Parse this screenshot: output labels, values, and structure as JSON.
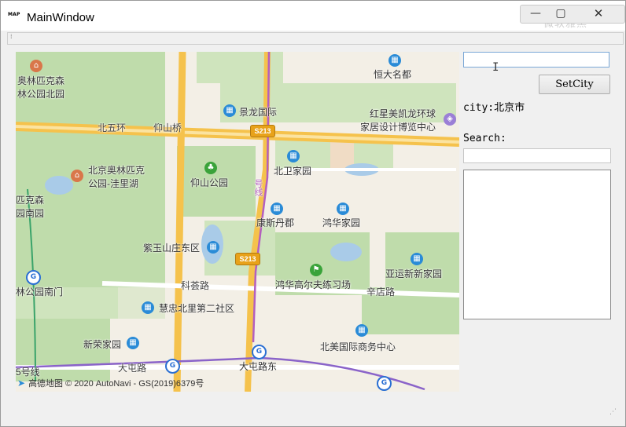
{
  "window": {
    "title": "MainWindow",
    "app_icon_text": "MAP",
    "controls": {
      "minimize": "—",
      "maximize": "▢",
      "close": "✕"
    },
    "watermark": "微软雅黑"
  },
  "map": {
    "labels": {
      "olympic_north_park": "奥林匹克森\n林公园北园",
      "hengda_mingdu": "恒大名都",
      "jinglong": "景龙国际",
      "redstar": "红星美凯龙环球\n家居设计博览中心",
      "beiwuhuan": "北五环",
      "yangshanqiao": "仰山桥",
      "olympic_wali": "北京奥林匹克\n公园-洼里湖",
      "yangshan_park": "仰山公园",
      "beiwei": "北卫家园",
      "olympic_south": "匹克森\n园南园",
      "kangsi": "康斯丹郡",
      "honghua": "鸿华家园",
      "ziyu": "紫玉山庄东区",
      "yayun": "亚运新新家园",
      "kehui": "科荟路",
      "honghua_golf": "鸿华高尔夫练习场",
      "xindian": "辛店路",
      "park_south_gate": "林公园南门",
      "huizhong": "慧忠北里第二社区",
      "beimei": "北美国际商务中心",
      "xinrong": "新荣家园",
      "datun_road": "大屯路",
      "datun_east": "大屯路东",
      "line5": "5号线",
      "line_number": "号线"
    },
    "shield": "S213",
    "footer": "高德地图 © 2020 AutoNavi - GS(2019)6379号"
  },
  "panel": {
    "city_input_value": "",
    "setcity_label": "SetCity",
    "city_label": "city:北京市",
    "search_label": "Search:",
    "search_value": ""
  }
}
